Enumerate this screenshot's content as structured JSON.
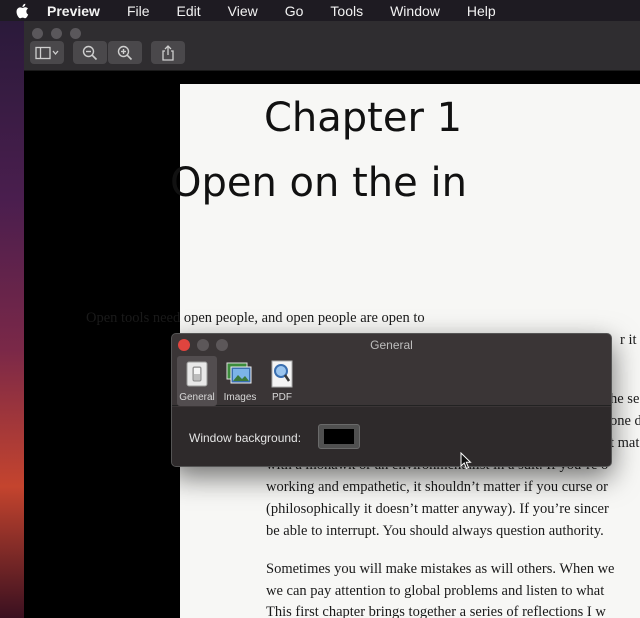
{
  "menubar": {
    "items": [
      "Preview",
      "File",
      "Edit",
      "View",
      "Go",
      "Tools",
      "Window",
      "Help"
    ]
  },
  "toolbar": {
    "buttons": [
      "sidebar-toggle-icon",
      "zoom-out-icon",
      "zoom-in-icon",
      "share-icon"
    ]
  },
  "document": {
    "chapter_title": "Chapter 1",
    "chapter_subtitle": "Open on the in",
    "paragraph1": [
      "Open tools need open people, and open people are open to",
      "r it i",
      "he se",
      "one d",
      "t mat",
      "with a mohawk or an environmentalist in a suit. If you’re o",
      "working and empathetic, it shouldn’t matter if you curse or",
      "(philosophically it doesn’t matter anyway). If you’re sincer",
      "be able to interrupt. You should always question authority."
    ],
    "paragraph2": [
      "Sometimes you will make mistakes as will others. When we",
      "we can pay attention to global problems and listen to what",
      "This first chapter brings together a series of reflections I w"
    ]
  },
  "prefs_panel": {
    "title": "General",
    "tabs": [
      "General",
      "Images",
      "PDF"
    ],
    "active_tab": "General",
    "window_background_label": "Window background:",
    "window_background_color": "#000000"
  },
  "colors": {
    "close_button": "#e0443e",
    "menubar_bg": "#1e1b22",
    "panel_bg": "#3a3536"
  }
}
